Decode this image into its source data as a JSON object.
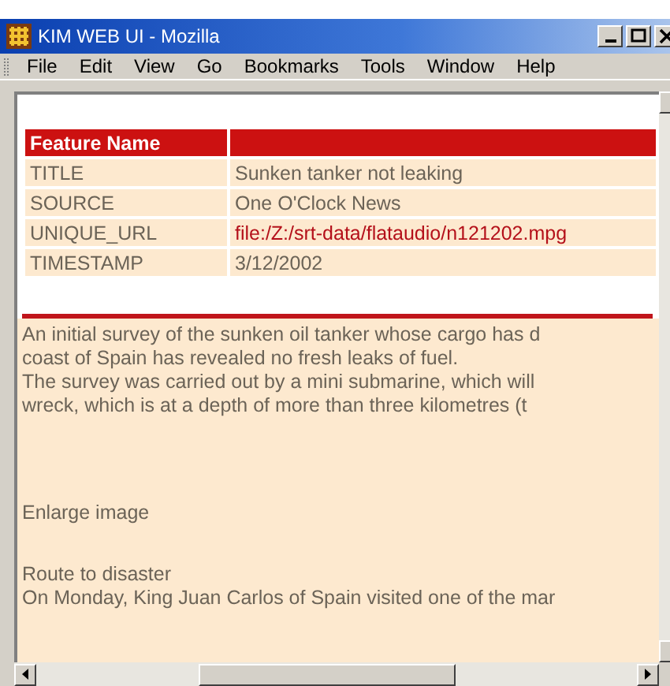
{
  "window": {
    "title": "KIM WEB UI - Mozilla"
  },
  "menu": [
    {
      "label": "File"
    },
    {
      "label": "Edit"
    },
    {
      "label": "View"
    },
    {
      "label": "Go"
    },
    {
      "label": "Bookmarks"
    },
    {
      "label": "Tools"
    },
    {
      "label": "Window"
    },
    {
      "label": "Help"
    }
  ],
  "table": {
    "columns": [
      "Feature Name"
    ],
    "rows": [
      {
        "name": "TITLE",
        "value": "Sunken tanker not leaking",
        "kind": "text"
      },
      {
        "name": "SOURCE",
        "value": "One O'Clock News",
        "kind": "text"
      },
      {
        "name": "UNIQUE_URL",
        "value": "file:/Z:/srt-data/flataudio/n121202.mpg",
        "kind": "link"
      },
      {
        "name": "TIMESTAMP",
        "value": "3/12/2002",
        "kind": "text"
      }
    ]
  },
  "article": [
    {
      "kind": "paragraph",
      "lines": [
        "An initial survey of the sunken oil tanker whose cargo has d",
        "coast of Spain has revealed no fresh leaks of fuel.",
        "The survey was carried out by a mini submarine, which will",
        "wreck, which is at a depth of more than three kilometres (t"
      ]
    },
    {
      "kind": "caption",
      "lines": [
        "Enlarge image"
      ]
    },
    {
      "kind": "paragraph",
      "lines": [
        "Route to disaster",
        "On Monday, King Juan Carlos of Spain visited one of the mar"
      ]
    }
  ]
}
